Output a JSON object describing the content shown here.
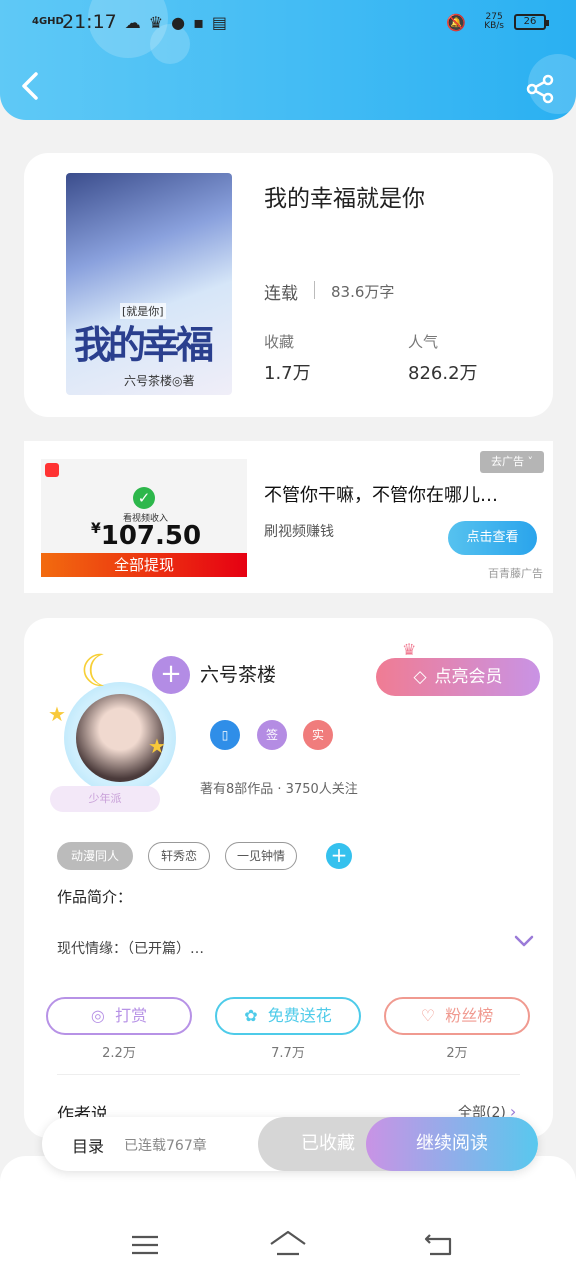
{
  "status_bar": {
    "network": "4GHD",
    "time": "21:17",
    "speed": "275\nKB/s",
    "battery": "26"
  },
  "book": {
    "cover_title_art": "我的幸福",
    "cover_tag_art": "[就是你]",
    "cover_author_art": "六号茶楼◎著",
    "title": "我的幸福就是你",
    "status": "连载",
    "word_count": "83.6万字",
    "favorites_label": "收藏",
    "favorites_value": "1.7万",
    "popularity_label": "人气",
    "popularity_value": "826.2万"
  },
  "ad": {
    "image_label": "看视频收入",
    "image_amount_symbol": "¥",
    "image_amount": "107.50",
    "image_button": "全部提现",
    "close_label": "去广告 ˅",
    "headline": "不管你干嘛，不管你在哪儿…",
    "subtitle": "刷视频赚钱",
    "cta": "点击查看",
    "source": "百青藤广告"
  },
  "author": {
    "name": "六号茶楼",
    "rank_badge": "少年派",
    "vip_button": "点亮会员",
    "badge_sign": "签",
    "badge_real": "实",
    "works_info": "著有8部作品 · 3750人关注",
    "tags": [
      "动漫同人",
      "轩秀恋",
      "一见钟情"
    ],
    "intro_label": "作品简介：",
    "intro_text": "现代情缘：（已开篇）…",
    "actions": [
      {
        "label": "打赏",
        "count": "2.2万",
        "color": "#b792e6"
      },
      {
        "label": "免费送花",
        "count": "7.7万",
        "color": "#4ecbe9"
      },
      {
        "label": "粉丝榜",
        "count": "2万",
        "color": "#f09a90"
      }
    ],
    "author_says": "作者说",
    "all_link": "全部(2)"
  },
  "bottom": {
    "toc_label": "目录",
    "toc_count": "已连载767章",
    "collected": "已收藏",
    "continue_reading": "继续阅读"
  }
}
